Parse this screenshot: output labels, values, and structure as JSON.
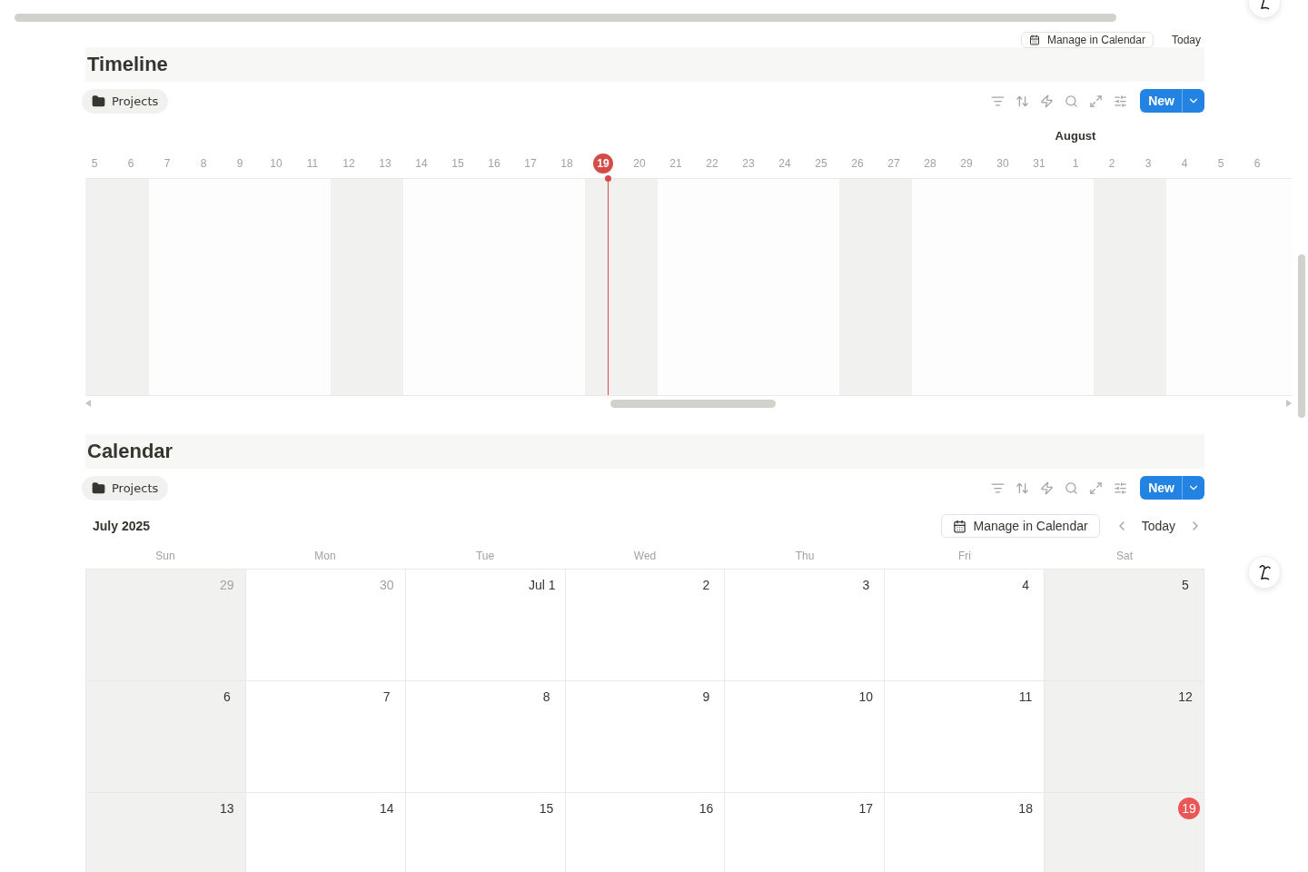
{
  "top_strip": {
    "manage_button": "Manage in Calendar",
    "today_button": "Today"
  },
  "timeline": {
    "title": "Timeline",
    "source": "Projects",
    "new_button": "New",
    "days": [
      {
        "label": "5",
        "weekend": true,
        "selected": false
      },
      {
        "label": "6",
        "weekend": true,
        "selected": false
      },
      {
        "label": "7",
        "weekend": false,
        "selected": false
      },
      {
        "label": "8",
        "weekend": false,
        "selected": false
      },
      {
        "label": "9",
        "weekend": false,
        "selected": false
      },
      {
        "label": "10",
        "weekend": false,
        "selected": false
      },
      {
        "label": "11",
        "weekend": false,
        "selected": false
      },
      {
        "label": "12",
        "weekend": true,
        "selected": false
      },
      {
        "label": "13",
        "weekend": true,
        "selected": false
      },
      {
        "label": "14",
        "weekend": false,
        "selected": false
      },
      {
        "label": "15",
        "weekend": false,
        "selected": false
      },
      {
        "label": "16",
        "weekend": false,
        "selected": false
      },
      {
        "label": "17",
        "weekend": false,
        "selected": false
      },
      {
        "label": "18",
        "weekend": false,
        "selected": false
      },
      {
        "label": "19",
        "weekend": true,
        "selected": true
      },
      {
        "label": "20",
        "weekend": true,
        "selected": false
      },
      {
        "label": "21",
        "weekend": false,
        "selected": false
      },
      {
        "label": "22",
        "weekend": false,
        "selected": false
      },
      {
        "label": "23",
        "weekend": false,
        "selected": false
      },
      {
        "label": "24",
        "weekend": false,
        "selected": false
      },
      {
        "label": "25",
        "weekend": false,
        "selected": false
      },
      {
        "label": "26",
        "weekend": true,
        "selected": false
      },
      {
        "label": "27",
        "weekend": true,
        "selected": false
      },
      {
        "label": "28",
        "weekend": false,
        "selected": false
      },
      {
        "label": "29",
        "weekend": false,
        "selected": false
      },
      {
        "label": "30",
        "weekend": false,
        "selected": false
      },
      {
        "label": "31",
        "weekend": false,
        "selected": false
      },
      {
        "label": "1",
        "month": "August",
        "weekend": false,
        "selected": false
      },
      {
        "label": "2",
        "weekend": true,
        "selected": false
      },
      {
        "label": "3",
        "weekend": true,
        "selected": false
      },
      {
        "label": "4",
        "weekend": false,
        "selected": false
      },
      {
        "label": "5",
        "weekend": false,
        "selected": false
      },
      {
        "label": "6",
        "weekend": false,
        "selected": false
      }
    ]
  },
  "calendar": {
    "title": "Calendar",
    "source": "Projects",
    "new_button": "New",
    "month": "July 2025",
    "manage_button": "Manage in Calendar",
    "today_button": "Today",
    "weekdays": [
      "Sun",
      "Mon",
      "Tue",
      "Wed",
      "Thu",
      "Fri",
      "Sat"
    ],
    "weeks": [
      [
        {
          "label": "29",
          "muted": true,
          "weekend": true,
          "selected": false
        },
        {
          "label": "30",
          "muted": true,
          "weekend": false,
          "selected": false
        },
        {
          "label": "Jul 1",
          "muted": false,
          "weekend": false,
          "selected": false
        },
        {
          "label": "2",
          "muted": false,
          "weekend": false,
          "selected": false
        },
        {
          "label": "3",
          "muted": false,
          "weekend": false,
          "selected": false
        },
        {
          "label": "4",
          "muted": false,
          "weekend": false,
          "selected": false
        },
        {
          "label": "5",
          "muted": false,
          "weekend": true,
          "selected": false
        }
      ],
      [
        {
          "label": "6",
          "muted": false,
          "weekend": true,
          "selected": false
        },
        {
          "label": "7",
          "muted": false,
          "weekend": false,
          "selected": false
        },
        {
          "label": "8",
          "muted": false,
          "weekend": false,
          "selected": false
        },
        {
          "label": "9",
          "muted": false,
          "weekend": false,
          "selected": false
        },
        {
          "label": "10",
          "muted": false,
          "weekend": false,
          "selected": false
        },
        {
          "label": "11",
          "muted": false,
          "weekend": false,
          "selected": false
        },
        {
          "label": "12",
          "muted": false,
          "weekend": true,
          "selected": false
        }
      ],
      [
        {
          "label": "13",
          "muted": false,
          "weekend": true,
          "selected": false
        },
        {
          "label": "14",
          "muted": false,
          "weekend": false,
          "selected": false
        },
        {
          "label": "15",
          "muted": false,
          "weekend": false,
          "selected": false
        },
        {
          "label": "16",
          "muted": false,
          "weekend": false,
          "selected": false
        },
        {
          "label": "17",
          "muted": false,
          "weekend": false,
          "selected": false
        },
        {
          "label": "18",
          "muted": false,
          "weekend": false,
          "selected": false
        },
        {
          "label": "19",
          "muted": false,
          "weekend": true,
          "selected": true
        }
      ]
    ]
  }
}
